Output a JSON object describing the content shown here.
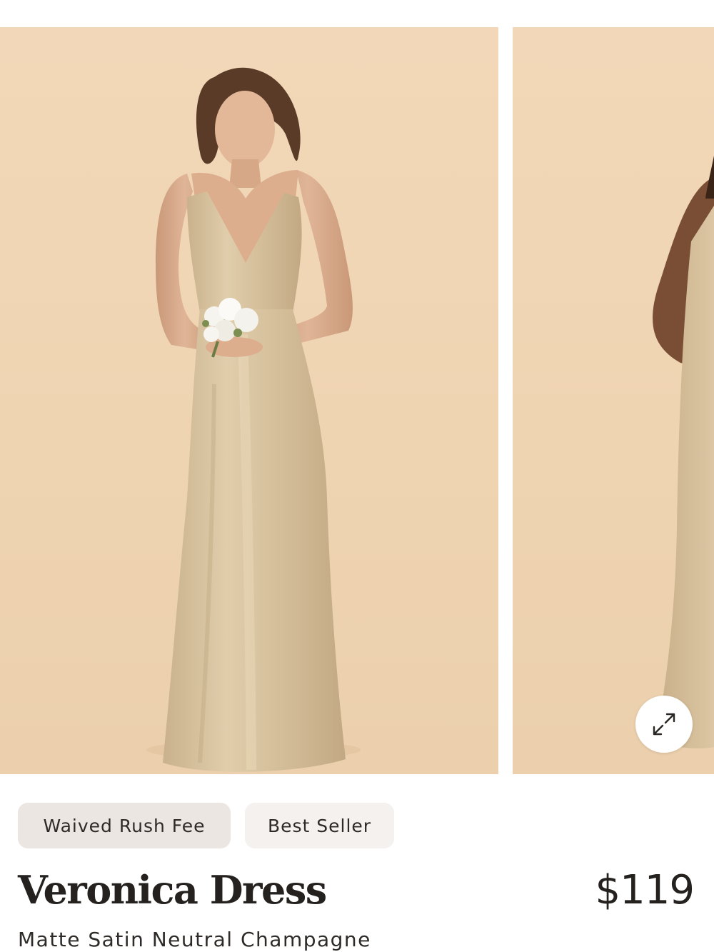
{
  "gallery": {
    "images": [
      {
        "alt": "Veronica Dress in Matte Satin Neutral Champagne, front view"
      },
      {
        "alt": "Veronica Dress in Matte Satin Neutral Champagne, alternate view"
      }
    ],
    "expand_icon": "expand-arrows-icon"
  },
  "badges": [
    {
      "label": "Waived Rush Fee"
    },
    {
      "label": "Best Seller"
    }
  ],
  "product": {
    "name": "Veronica Dress",
    "price": "$119",
    "variant": "Matte Satin Neutral Champagne"
  },
  "colors": {
    "backdrop": "#efd4b2",
    "dress": "#d8c3a0",
    "badge_primary": "#ebe6e1",
    "badge_secondary": "#f4f1ee",
    "text": "#24211f"
  }
}
